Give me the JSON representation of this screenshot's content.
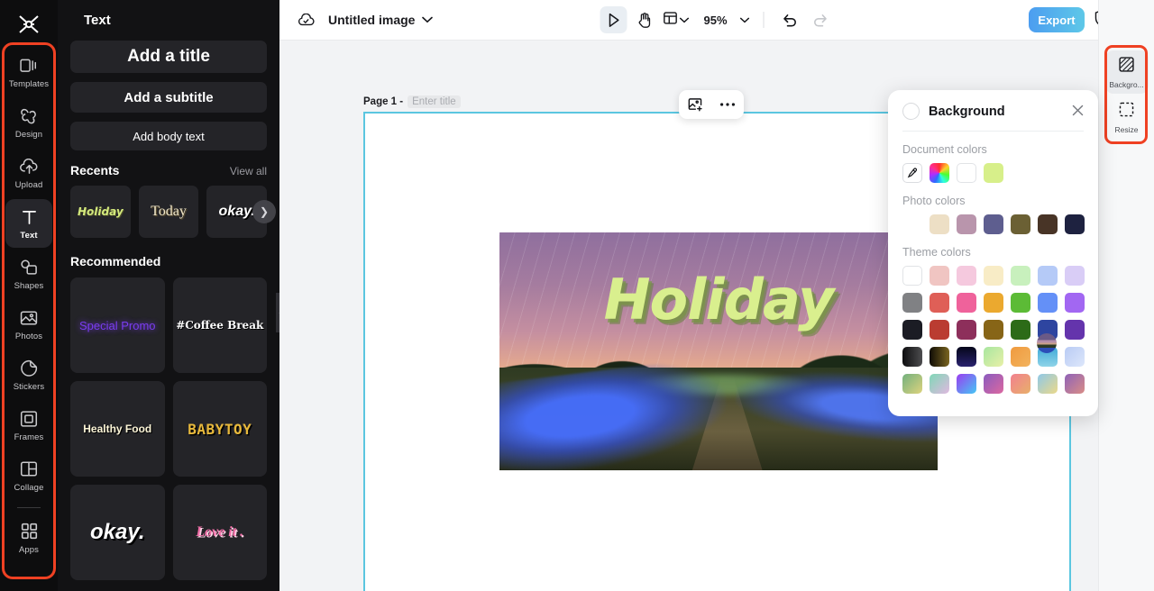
{
  "brand": {
    "logo_name": "capcut-logo"
  },
  "left_rail": {
    "items": [
      {
        "label": "Templates",
        "icon": "templates-icon",
        "active": false
      },
      {
        "label": "Design",
        "icon": "design-icon",
        "active": false
      },
      {
        "label": "Upload",
        "icon": "upload-icon",
        "active": false
      },
      {
        "label": "Text",
        "icon": "text-icon",
        "active": true
      },
      {
        "label": "Shapes",
        "icon": "shapes-icon",
        "active": false
      },
      {
        "label": "Photos",
        "icon": "photos-icon",
        "active": false
      },
      {
        "label": "Stickers",
        "icon": "stickers-icon",
        "active": false
      },
      {
        "label": "Frames",
        "icon": "frames-icon",
        "active": false
      },
      {
        "label": "Collage",
        "icon": "collage-icon",
        "active": false
      },
      {
        "label": "Apps",
        "icon": "apps-icon",
        "active": false
      }
    ],
    "highlight_color": "#ef4123"
  },
  "text_panel": {
    "title": "Text",
    "add_title": "Add a title",
    "add_subtitle": "Add a subtitle",
    "add_body": "Add body text",
    "recents_title": "Recents",
    "view_all": "View all",
    "recents": [
      {
        "label": "Holiday",
        "style": "s-holiday"
      },
      {
        "label": "Today",
        "style": "s-today"
      },
      {
        "label": "okay.",
        "style": "s-okay"
      }
    ],
    "recommended_title": "Recommended",
    "recommended": [
      {
        "label": "Special Promo",
        "style": "s-promo"
      },
      {
        "label": "#Coffee Break",
        "style": "s-coffee"
      },
      {
        "label": "Healthy Food",
        "style": "s-healthy"
      },
      {
        "label": "BABYTOY",
        "style": "s-baby"
      },
      {
        "label": "okay.",
        "style": "s-okay2"
      },
      {
        "label": "Love it .",
        "style": "s-love"
      }
    ]
  },
  "topbar": {
    "cloud_icon": "cloud-saved-icon",
    "doc_title": "Untitled image",
    "title_chevron": "chevron-down-icon",
    "select_tool": "cursor-select-icon",
    "hand_tool": "hand-pan-icon",
    "layout_tool": "layout-icon",
    "zoom_level": "95%",
    "undo": "undo-icon",
    "redo": "redo-icon",
    "export_label": "Export",
    "shield_icon": "shield-icon",
    "avatar": "user-avatar"
  },
  "canvas": {
    "page_label": "Page 1 -",
    "title_placeholder": "Enter title",
    "float_tools": [
      {
        "icon": "add-image-icon"
      },
      {
        "icon": "more-options-icon"
      }
    ],
    "artwork_text": "Holiday",
    "artwork_text_color": "#d9ef8e",
    "selection_color": "#5bc6e0"
  },
  "background_panel": {
    "title": "Background",
    "close_icon": "close-icon",
    "document_colors_label": "Document colors",
    "document_colors": [
      {
        "name": "eyedropper",
        "type": "picker"
      },
      {
        "name": "color-wheel",
        "type": "wheel"
      },
      {
        "name": "white",
        "type": "solid",
        "hex": "#ffffff"
      },
      {
        "name": "lime",
        "type": "solid",
        "hex": "#d7ef8a"
      }
    ],
    "photo_colors_label": "Photo colors",
    "photo_colors": [
      {
        "name": "photo-thumb",
        "type": "photo"
      },
      {
        "name": "cream",
        "type": "solid",
        "hex": "#eddfc5"
      },
      {
        "name": "mauve",
        "type": "solid",
        "hex": "#b995ac"
      },
      {
        "name": "slate-violet",
        "type": "solid",
        "hex": "#5e5e8f"
      },
      {
        "name": "olive",
        "type": "solid",
        "hex": "#6b6034"
      },
      {
        "name": "dark-brown",
        "type": "solid",
        "hex": "#483426"
      },
      {
        "name": "midnight",
        "type": "solid",
        "hex": "#1e2240"
      }
    ],
    "theme_colors_label": "Theme colors",
    "theme_colors": [
      "#ffffff",
      "#f0c5c2",
      "#f5c9de",
      "#f8ecc6",
      "#c8f0bd",
      "#b5caf7",
      "#d9cdf6",
      "#808184",
      "#df5f57",
      "#ef629b",
      "#eba92f",
      "#5cbb36",
      "#6490f7",
      "#a267f2",
      "#1b1c24",
      "#ba3c31",
      "#8d2f5b",
      "#876517",
      "#2c6b18",
      "#2e45a0",
      "#6434ac",
      "linear-gradient(90deg,#0d0d0f,#4d4d4f)",
      "linear-gradient(90deg,#0f0c05,#7a6520)",
      "linear-gradient(180deg,#05061a,#29226e)",
      "linear-gradient(135deg,#a8e6a0,#e8f0a8)",
      "linear-gradient(135deg,#f09a3e,#f2b35e)",
      "linear-gradient(180deg,#3fa9d8,#8fd4e8)",
      "linear-gradient(135deg,#b9cbf4,#dde7fb)",
      "linear-gradient(135deg,#72b07e,#ddd37e)",
      "linear-gradient(135deg,#7fd7b6,#e0b9e0)",
      "linear-gradient(135deg,#9b3cf0,#44c8f5)",
      "linear-gradient(135deg,#8a5bbf,#dc68a0)",
      "linear-gradient(135deg,#f2808f,#e8b06a)",
      "linear-gradient(135deg,#8ec8e8,#ecd98a)",
      "linear-gradient(135deg,#8f62b8,#d98d86)"
    ]
  },
  "right_rail": {
    "items": [
      {
        "label": "Backgro...",
        "icon": "background-icon",
        "active": true
      },
      {
        "label": "Resize",
        "icon": "resize-icon",
        "active": false
      }
    ],
    "highlight_color": "#ef4123"
  }
}
